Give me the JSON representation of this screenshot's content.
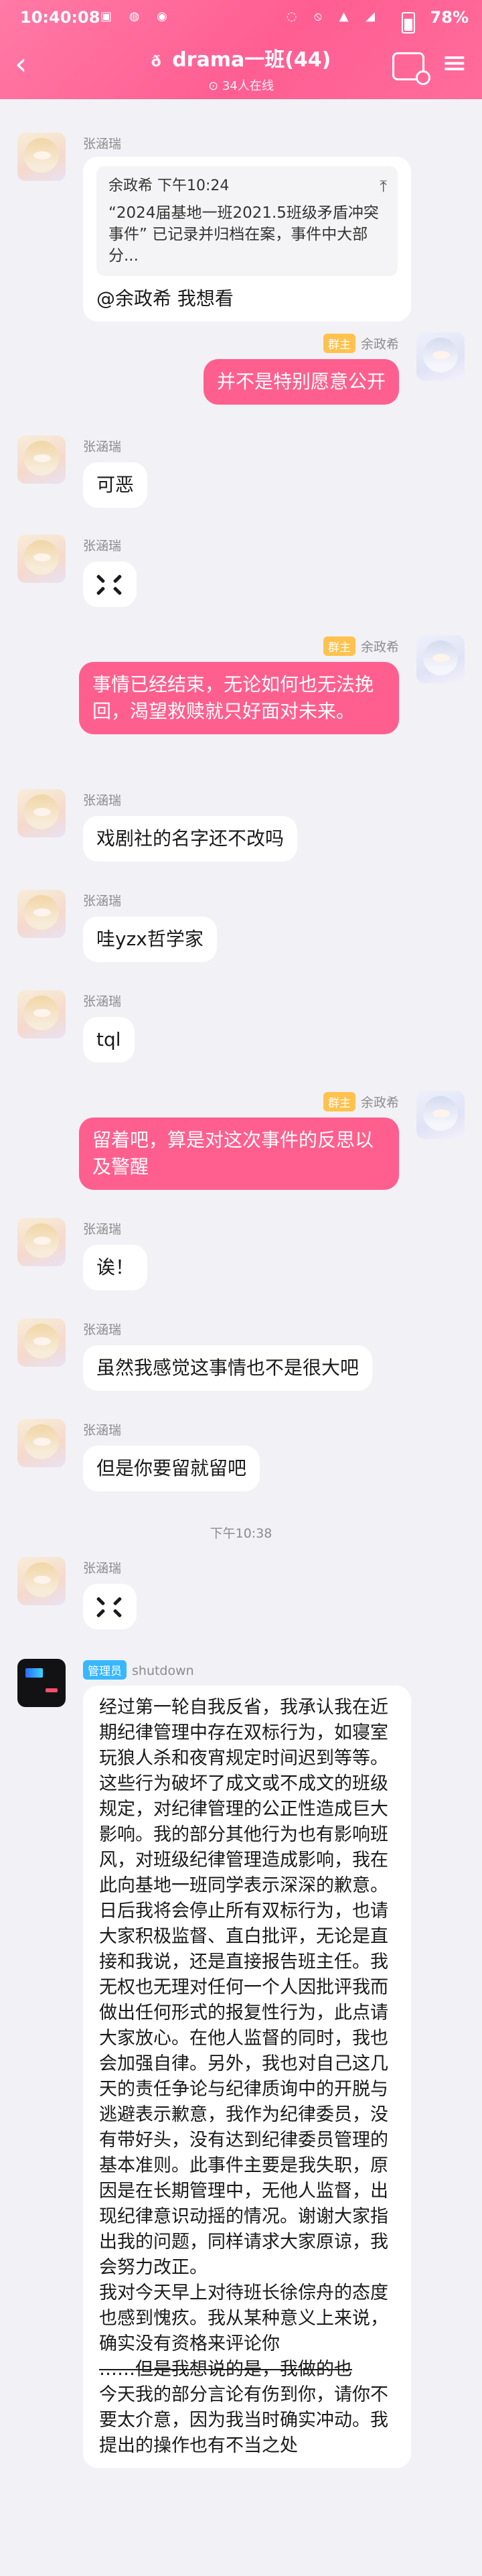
{
  "status": {
    "time": "10:40:08",
    "battery": "78%"
  },
  "header": {
    "title": "drama一班(44)",
    "online": "34人在线"
  },
  "names": {
    "zhang": "张涵瑞",
    "yu": "余政希",
    "shutdown": "shutdown"
  },
  "badges": {
    "owner": "群主",
    "admin": "管理员"
  },
  "quote": {
    "author": "余政希",
    "time": "下午10:24",
    "text": "“2024届基地一班2021.5班级矛盾冲突事件” 已记录并归档在案，事件中大部分..."
  },
  "messages": {
    "m1": "@余政希 我想看",
    "m2": "并不是特别愿意公开",
    "m3": "可恶",
    "m5": "事情已经结束，无论如何也无法挽回，渴望救赎就只好面对未来。",
    "m6": "戏剧社的名字还不改吗",
    "m7": "哇yzx哲学家",
    "m8": "tql",
    "m9": "留着吧，算是对这次事件的反思以及警醒",
    "m10": "诶！",
    "m11": "虽然我感觉这事情也不是很大吧",
    "m12": "但是你要留就留吧",
    "time_sep": "下午10:38",
    "final_p1": "经过第一轮自我反省，我承认我在近期纪律管理中存在双标行为，如寝室玩狼人杀和夜宵规定时间迟到等等。这些行为破坏了成文或不成文的班级规定，对纪律管理的公正性造成巨大影响。我的部分其他行为也有影响班风，对班级纪律管理造成影响，我在此向基地一班同学表示深深的歉意。日后我将会停止所有双标行为，也请大家积极监督、直白批评，无论是直接和我说，还是直接报告班主任。我无权也无理对任何一个人因批评我而做出任何形式的报复性行为，此点请大家放心。在他人监督的同时，我也会加强自律。另外，我也对自己这几天的责任争论与纪律质询中的开脱与逃避表示歉意，我作为纪律委员，没有带好头，没有达到纪律委员管理的基本准则。此事件主要是我失职，原因是在长期管理中，无他人监督，出现纪律意识动摇的情况。谢谢大家指出我的问题，同样请求大家原谅，我会努力改正。",
    "final_p2": "我对今天早上对待班长徐倧舟的态度也感到愧疚。我从某种意义上来说，确实没有资格来评论你",
    "final_p3": "……但是我想说的是，我做的也",
    "final_p4": "今天我的部分言论有伤到你，请你不要太介意，因为我当时确实冲动。我提出的操作也有不当之处"
  }
}
